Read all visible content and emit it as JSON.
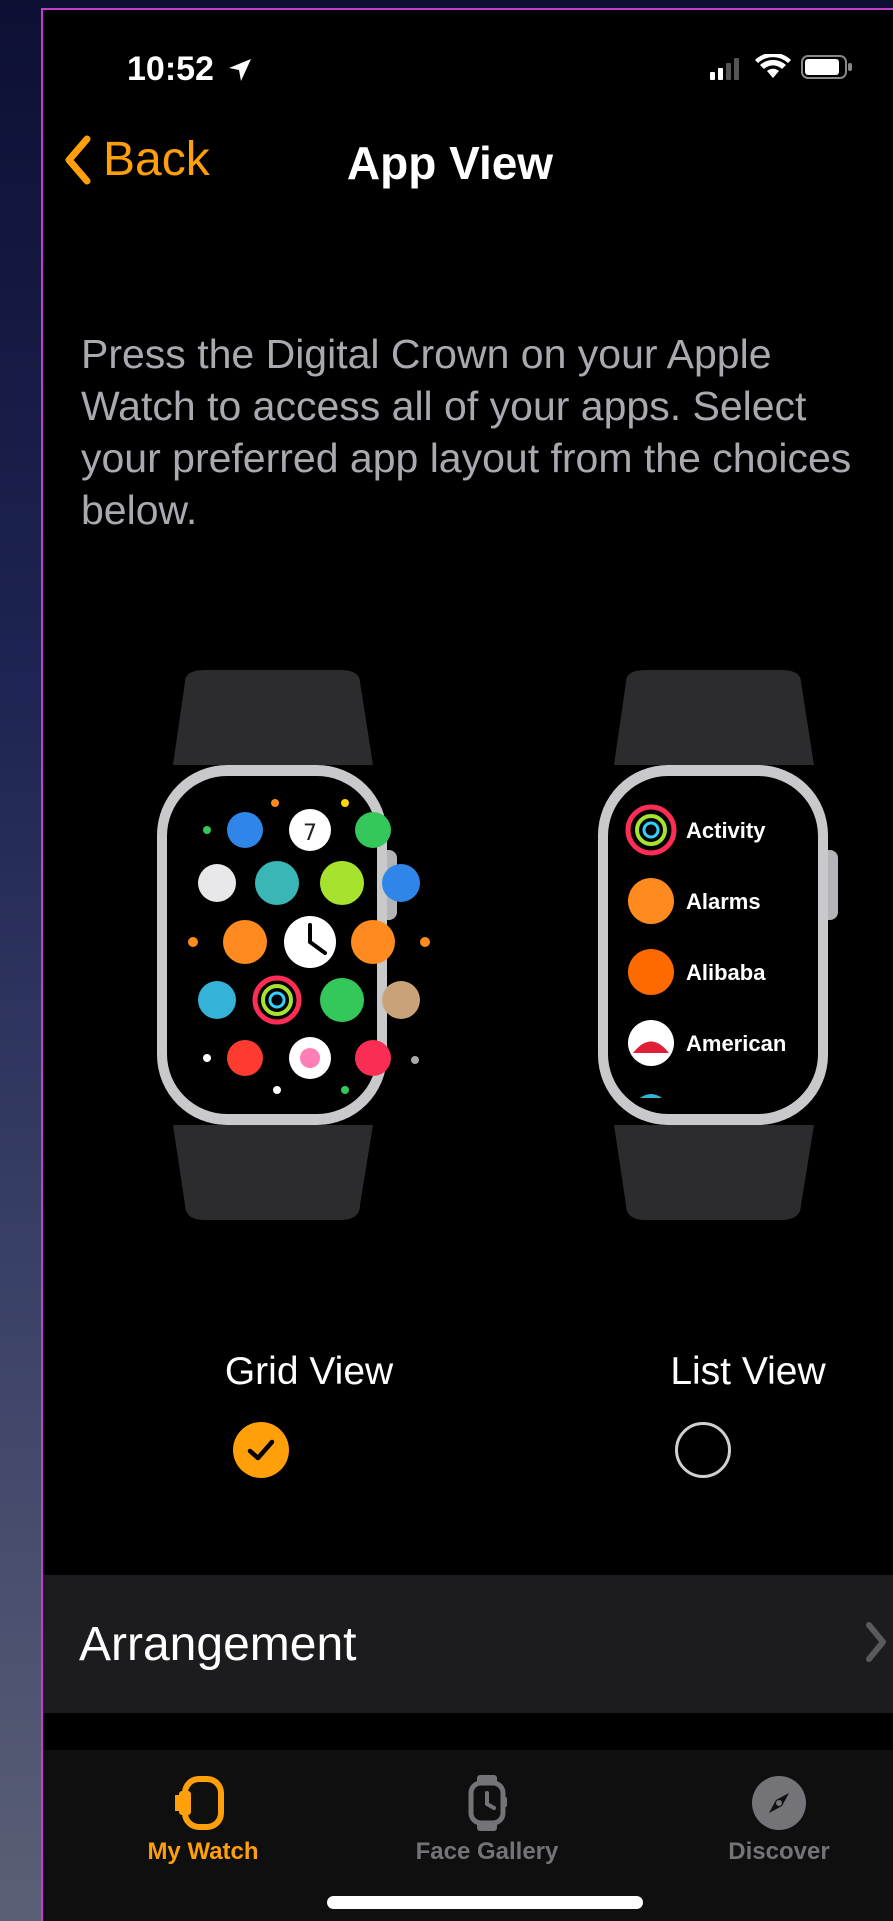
{
  "status_bar": {
    "time": "10:52"
  },
  "nav": {
    "back_label": "Back",
    "title": "App View"
  },
  "description": "Press the Digital Crown on your Apple Watch to access all of your apps. Select your preferred app layout from the choices below.",
  "layouts": {
    "grid": {
      "label": "Grid View",
      "selected": true,
      "calendar_day": "7"
    },
    "list": {
      "label": "List View",
      "selected": false,
      "apps": [
        "Activity",
        "Alarms",
        "Alibaba",
        "American"
      ]
    }
  },
  "arrangement": {
    "label": "Arrangement"
  },
  "tabbar": {
    "items": [
      {
        "label": "My Watch",
        "active": true,
        "icon": "watch-icon"
      },
      {
        "label": "Face Gallery",
        "active": false,
        "icon": "watch-face-icon"
      },
      {
        "label": "Discover",
        "active": false,
        "icon": "compass-icon"
      }
    ]
  },
  "colors": {
    "accent": "#ff9f0a",
    "background": "#000000",
    "row": "#1c1c1e",
    "inactive": "#737378"
  }
}
